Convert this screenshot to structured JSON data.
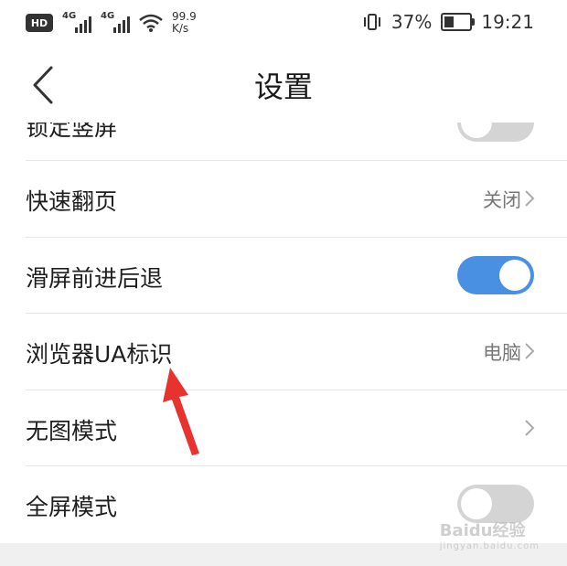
{
  "status_bar": {
    "hd_label": "HD",
    "signal1_label": "4G",
    "signal2_label": "4G",
    "speed_value": "99.9",
    "speed_unit": "K/s",
    "battery_percent": "37%",
    "battery_level": 0.37,
    "time": "19:21"
  },
  "header": {
    "title": "设置",
    "back_icon": "chevron-left-icon"
  },
  "settings": [
    {
      "label": "锁定竖屏",
      "control": "toggle",
      "on": false,
      "partially_visible": true
    },
    {
      "label": "快速翻页",
      "value": "关闭",
      "control": "chevron"
    },
    {
      "label": "滑屏前进后退",
      "control": "toggle",
      "on": true
    },
    {
      "label": "浏览器UA标识",
      "value": "电脑",
      "control": "chevron"
    },
    {
      "label": "无图模式",
      "value": "",
      "control": "chevron"
    },
    {
      "label": "全屏模式",
      "control": "toggle",
      "on": false
    }
  ],
  "colors": {
    "toggle_on": "#4a90e2",
    "toggle_off": "#d4d4d4",
    "annotation_arrow": "#e8322e"
  },
  "watermark": {
    "text": "Baidu经验",
    "subtext": "jingyan.baidu.com"
  }
}
